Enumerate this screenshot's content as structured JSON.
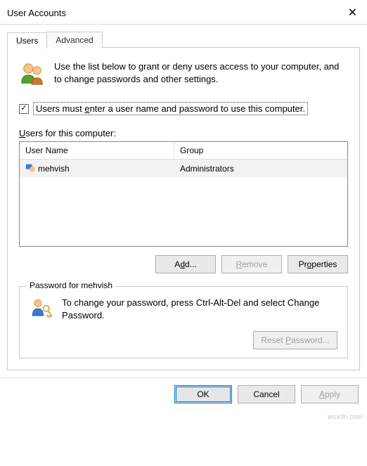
{
  "window": {
    "title": "User Accounts"
  },
  "tabs": {
    "users": "Users",
    "advanced": "Advanced"
  },
  "intro": "Use the list below to grant or deny users access to your computer, and to change passwords and other settings.",
  "checkbox": {
    "checked": "✓",
    "label_before": "Users must ",
    "label_key": "e",
    "label_after": "nter a user name and password to use this computer."
  },
  "users_label_before": "",
  "users_label_key": "U",
  "users_label_after": "sers for this computer:",
  "table": {
    "header": {
      "name": "User Name",
      "group": "Group"
    },
    "rows": [
      {
        "name": "mehvish",
        "group": "Administrators"
      }
    ]
  },
  "buttons": {
    "add_before": "A",
    "add_key": "d",
    "add_after": "d...",
    "remove_key": "R",
    "remove_after": "emove",
    "properties_before": "Pr",
    "properties_key": "o",
    "properties_after": "perties"
  },
  "password_box": {
    "legend": "Password for mehvish",
    "text": "To change your password, press Ctrl-Alt-Del and select Change Password.",
    "reset_before": "Reset ",
    "reset_key": "P",
    "reset_after": "assword..."
  },
  "dialog_buttons": {
    "ok": "OK",
    "cancel": "Cancel",
    "apply_key": "A",
    "apply_after": "pply"
  },
  "watermark": "wsxdn.com"
}
